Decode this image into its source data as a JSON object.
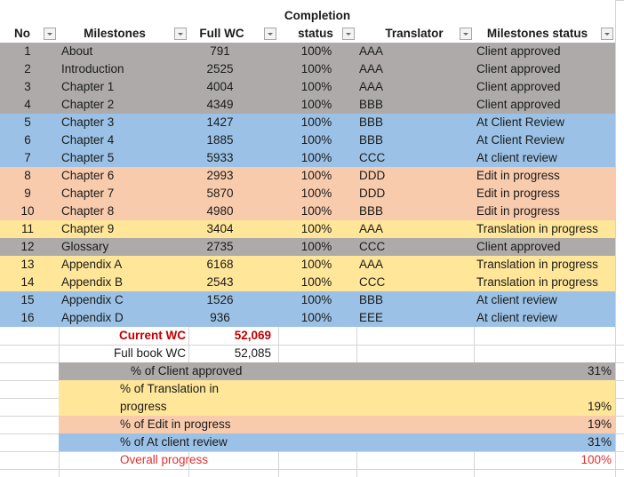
{
  "header": {
    "no": "No",
    "milestones": "Milestones",
    "full_wc": "Full WC",
    "completion_line1": "Completion",
    "completion_line2": "status",
    "translator": "Translator",
    "milestones_status": "Milestones status"
  },
  "colors": {
    "client_approved": "#aeaaaa",
    "at_client_review": "#9bc2e6",
    "edit_in_progress": "#f8cbad",
    "translation_in_progress": "#ffe699",
    "accent_red": "#c00000"
  },
  "rows": [
    {
      "no": "1",
      "milestone": "About",
      "wc": "791",
      "completion": "100%",
      "translator": "AAA",
      "status": "Client approved",
      "color": "gray"
    },
    {
      "no": "2",
      "milestone": "Introduction",
      "wc": "2525",
      "completion": "100%",
      "translator": "AAA",
      "status": "Client approved",
      "color": "gray"
    },
    {
      "no": "3",
      "milestone": "Chapter 1",
      "wc": "4004",
      "completion": "100%",
      "translator": "AAA",
      "status": "Client approved",
      "color": "gray"
    },
    {
      "no": "4",
      "milestone": "Chapter 2",
      "wc": "4349",
      "completion": "100%",
      "translator": "BBB",
      "status": "Client approved",
      "color": "gray"
    },
    {
      "no": "5",
      "milestone": "Chapter 3",
      "wc": "1427",
      "completion": "100%",
      "translator": "BBB",
      "status": "At Client Review",
      "color": "blue"
    },
    {
      "no": "6",
      "milestone": "Chapter 4",
      "wc": "1885",
      "completion": "100%",
      "translator": "BBB",
      "status": "At Client Review",
      "color": "blue"
    },
    {
      "no": "7",
      "milestone": "Chapter 5",
      "wc": "5933",
      "completion": "100%",
      "translator": "CCC",
      "status": "At client review",
      "color": "blue"
    },
    {
      "no": "8",
      "milestone": "Chapter 6",
      "wc": "2993",
      "completion": "100%",
      "translator": "DDD",
      "status": "Edit in progress",
      "color": "orange"
    },
    {
      "no": "9",
      "milestone": "Chapter 7",
      "wc": "5870",
      "completion": "100%",
      "translator": "DDD",
      "status": "Edit in progress",
      "color": "orange"
    },
    {
      "no": "10",
      "milestone": "Chapter 8",
      "wc": "4980",
      "completion": "100%",
      "translator": "BBB",
      "status": "Edit in progress",
      "color": "orange"
    },
    {
      "no": "11",
      "milestone": "Chapter 9",
      "wc": "3404",
      "completion": "100%",
      "translator": "AAA",
      "status": "Translation in progress",
      "color": "yellow"
    },
    {
      "no": "12",
      "milestone": "Glossary",
      "wc": "2735",
      "completion": "100%",
      "translator": "CCC",
      "status": "Client approved",
      "color": "gray"
    },
    {
      "no": "13",
      "milestone": "Appendix A",
      "wc": "6168",
      "completion": "100%",
      "translator": "AAA",
      "status": "Translation in progress",
      "color": "yellow"
    },
    {
      "no": "14",
      "milestone": "Appendix B",
      "wc": "2543",
      "completion": "100%",
      "translator": "CCC",
      "status": "Translation in progress",
      "color": "yellow"
    },
    {
      "no": "15",
      "milestone": "Appendix C",
      "wc": "1526",
      "completion": "100%",
      "translator": "BBB",
      "status": "At client review",
      "color": "blue"
    },
    {
      "no": "16",
      "milestone": "Appendix D",
      "wc": "936",
      "completion": "100%",
      "translator": "EEE",
      "status": "At client review",
      "color": "blue"
    }
  ],
  "summary": {
    "current_wc_label": "Current WC",
    "current_wc_value": "52,069",
    "full_book_wc_label": "Full book WC",
    "full_book_wc_value": "52,085",
    "client_approved_label": "% of Client approved",
    "client_approved_pct": "31%",
    "translation_label_line1": "% of Translation in",
    "translation_label_line2": "progress",
    "translation_pct": "19%",
    "edit_label": "% of Edit in progress",
    "edit_pct": "19%",
    "at_client_review_label": "% of At client review",
    "at_client_review_pct": "31%",
    "overall_label": "Overall progress",
    "overall_pct": "100%"
  }
}
